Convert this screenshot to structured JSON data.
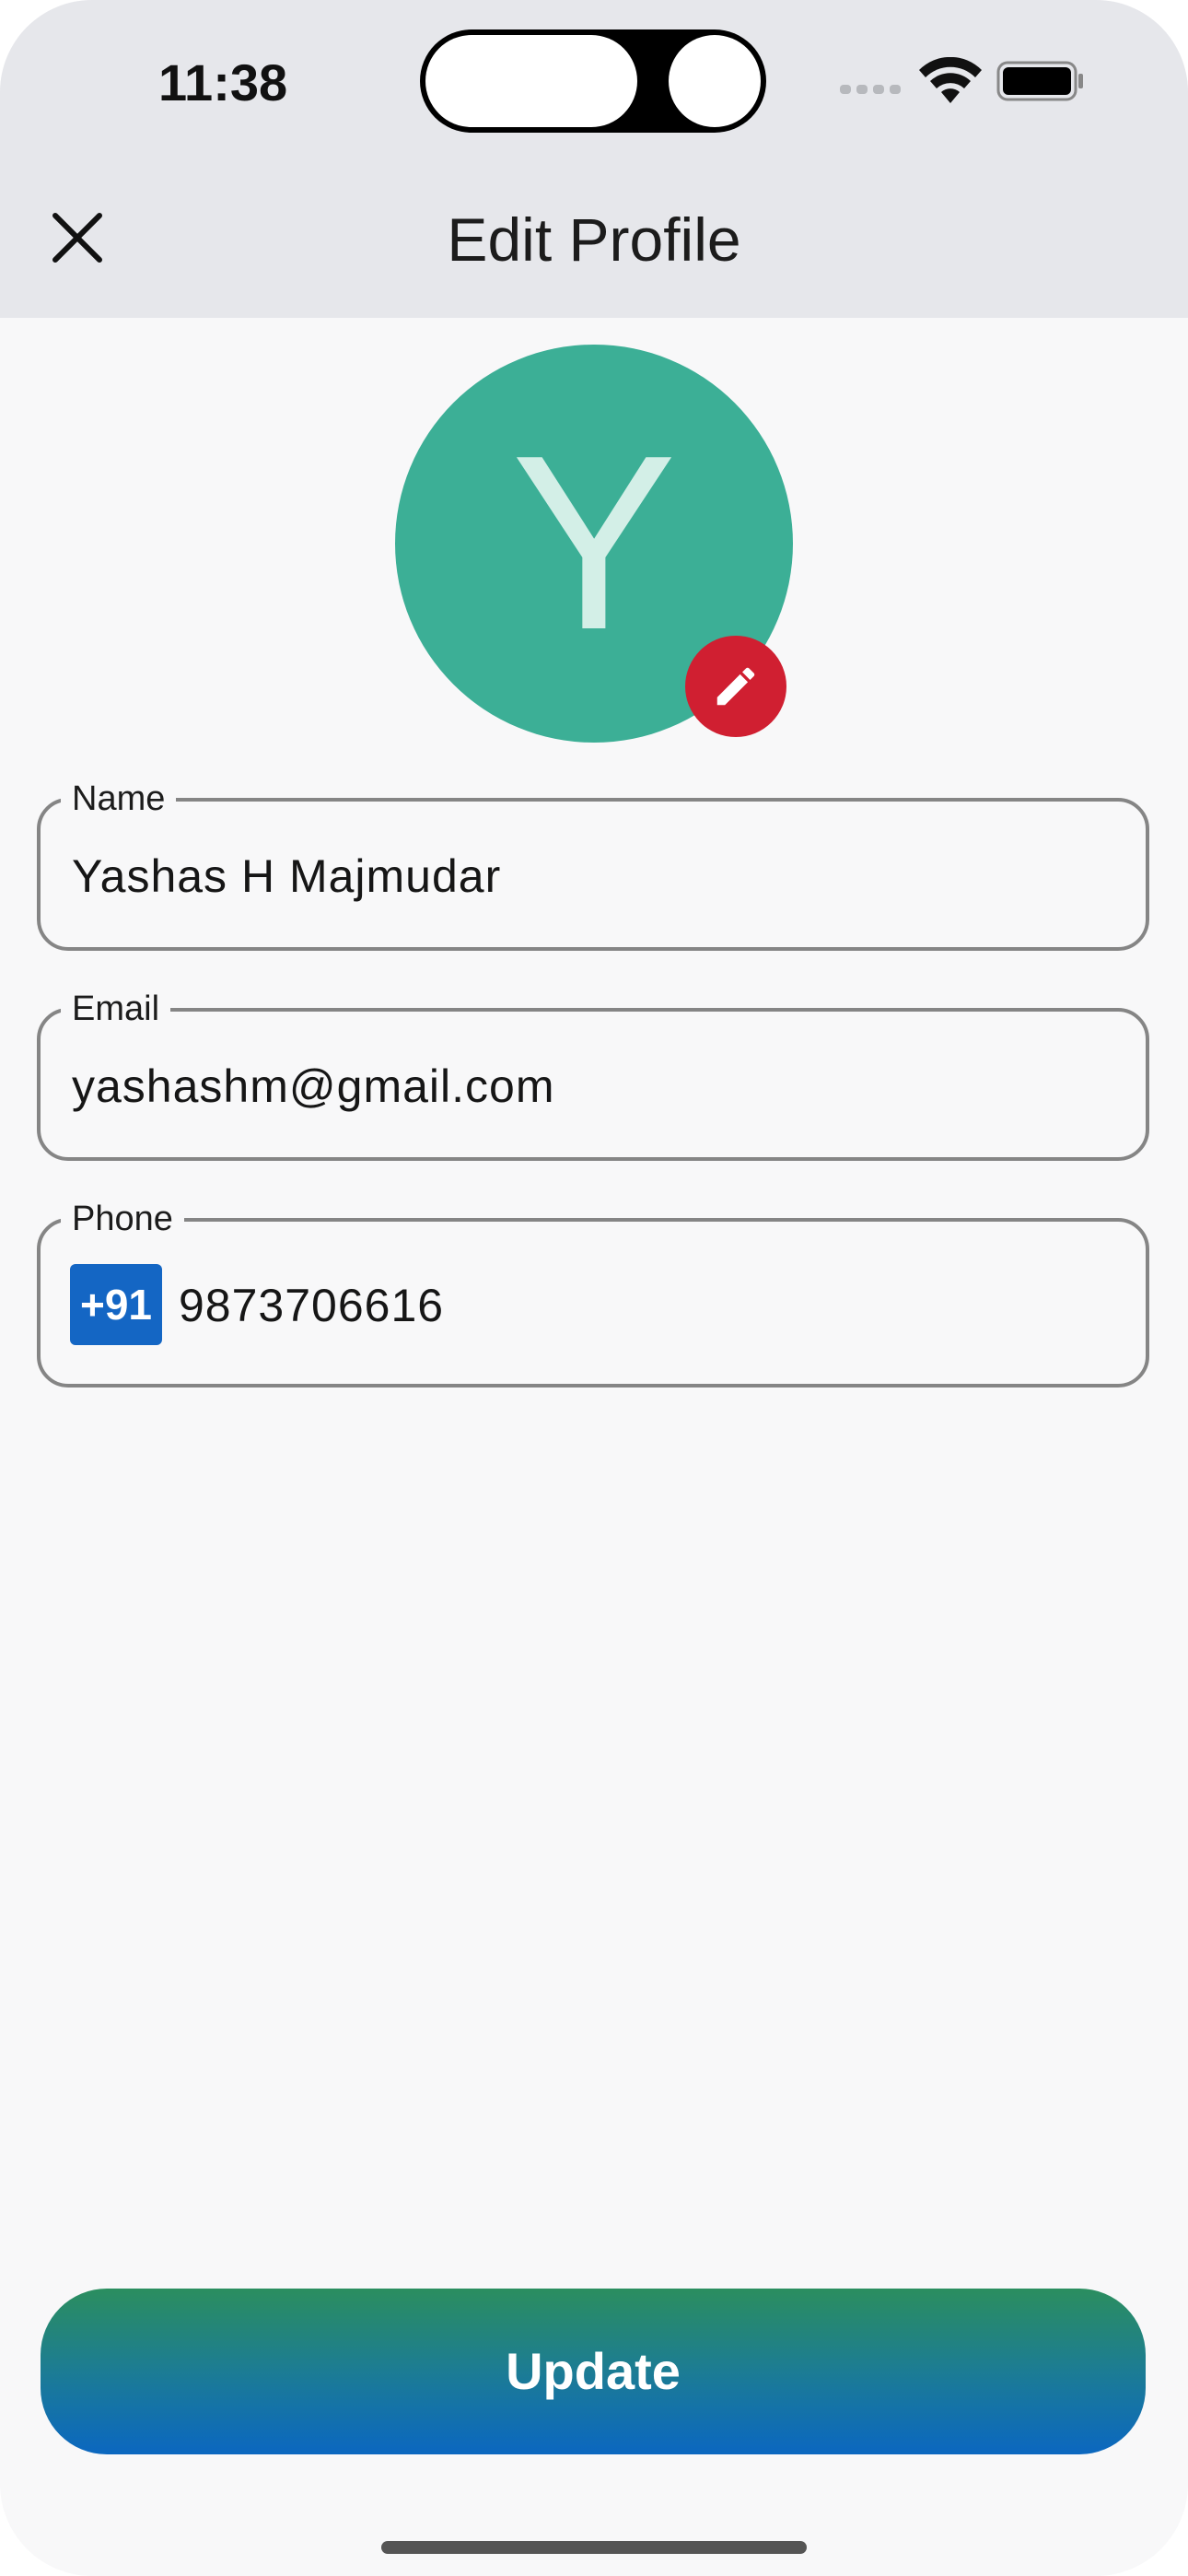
{
  "status_bar": {
    "time": "11:38"
  },
  "header": {
    "title": "Edit Profile",
    "close_icon": "close-icon"
  },
  "avatar": {
    "initial": "Y",
    "bg_color": "#3caf96",
    "edit_icon": "pencil-icon",
    "edit_badge_color": "#d01f31"
  },
  "form": {
    "name": {
      "label": "Name",
      "value": "Yashas H Majmudar"
    },
    "email": {
      "label": "Email",
      "value": "yashashm@gmail.com"
    },
    "phone": {
      "label": "Phone",
      "country_code": "+91",
      "value": "9873706616"
    }
  },
  "actions": {
    "update_label": "Update"
  },
  "colors": {
    "accent_blue": "#1466c4",
    "button_gradient_top": "#2b8e5f",
    "button_gradient_bottom": "#0b67c0"
  }
}
